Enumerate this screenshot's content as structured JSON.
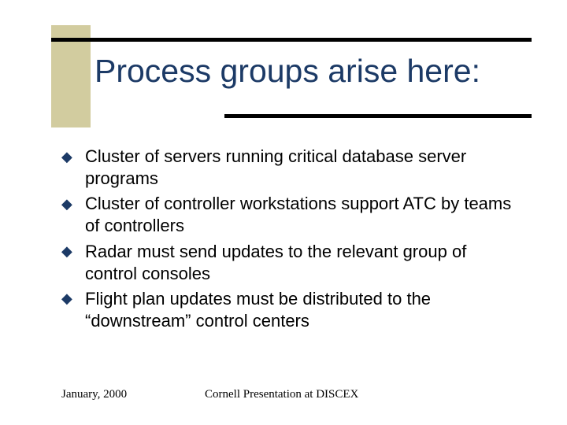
{
  "title": "Process groups arise here:",
  "bullets": [
    "Cluster of servers running critical database server programs",
    "Cluster of controller workstations support ATC by teams of controllers",
    "Radar must send updates to the relevant group of control consoles",
    "Flight plan updates must be distributed to the “downstream” control centers"
  ],
  "footer": {
    "left": "January, 2000",
    "center": "Cornell Presentation at DISCEX"
  }
}
